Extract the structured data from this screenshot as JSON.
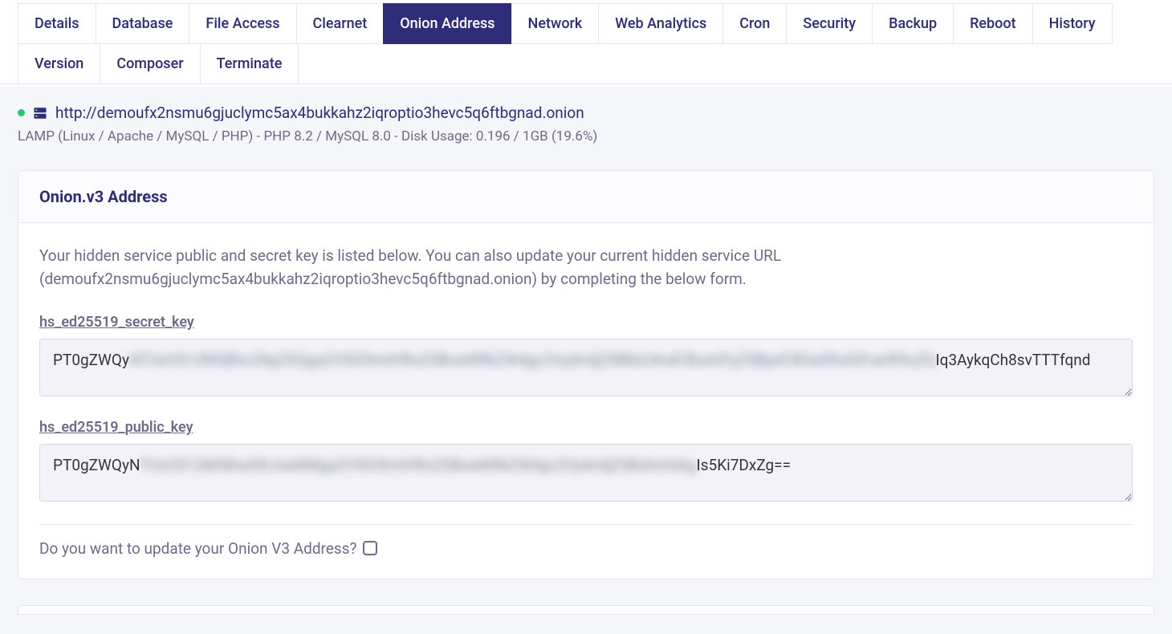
{
  "tabs": {
    "row1": [
      "Details",
      "Database",
      "File Access",
      "Clearnet",
      "Onion Address",
      "Network",
      "Web Analytics",
      "Cron",
      "Security",
      "Backup",
      "Reboot"
    ],
    "row2": [
      "History",
      "Version",
      "Composer",
      "Terminate"
    ],
    "active": "Onion Address"
  },
  "server": {
    "url": "http://demoufx2nsmu6gjuclymc5ax4bukkahz2iqroptio3hevc5q6ftbgnad.onion",
    "meta": "LAMP (Linux / Apache / MySQL / PHP) - PHP 8.2 / MySQL 8.0 - Disk Usage: 0.196 / 1GB (19.6%)"
  },
  "panel": {
    "title": "Onion.v3 Address",
    "description": "Your hidden service public and secret key is listed below. You can also update your current hidden service URL (demoufx2nsmu6gjuclymc5ax4bukkahz2iqroptio3hevc5q6ftbgnad.onion) by completing the below form.",
    "secret_label": "hs_ed25519_secret_key",
    "secret_prefix": "PT0gZWQy",
    "secret_obscured": "NTUxOS12MSBhc2NyZXQga2V5IG9mIHRoZSBoaWRkZW4gc2VydmljZSBkb24ndCBzaGFyZSBpdCB3aXRoIGFueW9uZQ",
    "secret_suffix": "Iq3AykqCh8svTTTfqnd",
    "public_label": "hs_ed25519_public_key",
    "public_prefix": "PT0gZWQyN",
    "public_obscured": "TUxOS12MSBwdWJsaWMga2V5IG9mIHRoZSBoaWRkZW4gc2VydmljZSBvbmlvbg",
    "public_suffix": "Is5Ki7DxZg==",
    "update_prompt": "Do you want to update your Onion V3 Address?"
  }
}
